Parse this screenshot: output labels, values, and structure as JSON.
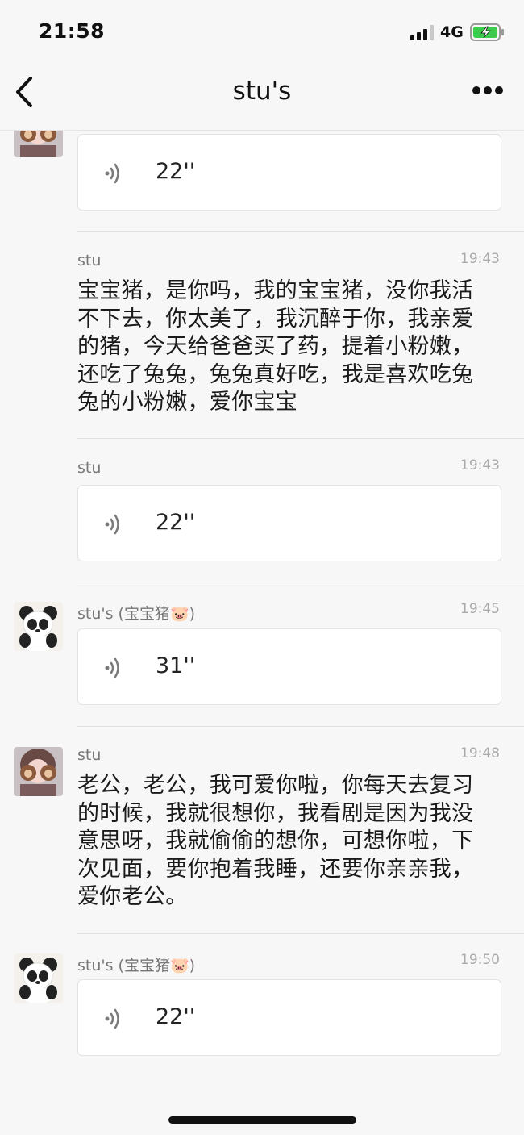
{
  "status_bar": {
    "time": "21:58",
    "network": "4G"
  },
  "nav": {
    "title": "stu's"
  },
  "messages": [
    {
      "type": "voice",
      "duration": "22''"
    },
    {
      "type": "text",
      "sender": "stu",
      "time": "19:43",
      "lines": [
        "宝宝猪，是你吗，我的宝宝猪，没你我活",
        "不下去，你太美了，我沉醉于你，我亲爱",
        "的猪，今天给爸爸买了药，提着小粉嫩，",
        "还吃了兔兔，兔兔真好吃，我是喜欢吃兔",
        "兔的小粉嫩，爱你宝宝"
      ]
    },
    {
      "type": "voice",
      "sender": "stu",
      "time": "19:43",
      "duration": "22''"
    },
    {
      "type": "voice",
      "sender": "stu's (宝宝猪🐷)",
      "time": "19:45",
      "duration": "31''"
    },
    {
      "type": "text",
      "sender": "stu",
      "time": "19:48",
      "lines": [
        "老公，老公，我可爱你啦，你每天去复习",
        "的时候，我就很想你，我看剧是因为我没",
        "意思呀，我就偷偷的想你，可想你啦，下",
        "次见面，要你抱着我睡，还要你亲亲我，",
        "爱你老公。"
      ]
    },
    {
      "type": "voice",
      "sender": "stu's (宝宝猪🐷)",
      "time": "19:50",
      "duration": "22''"
    }
  ]
}
